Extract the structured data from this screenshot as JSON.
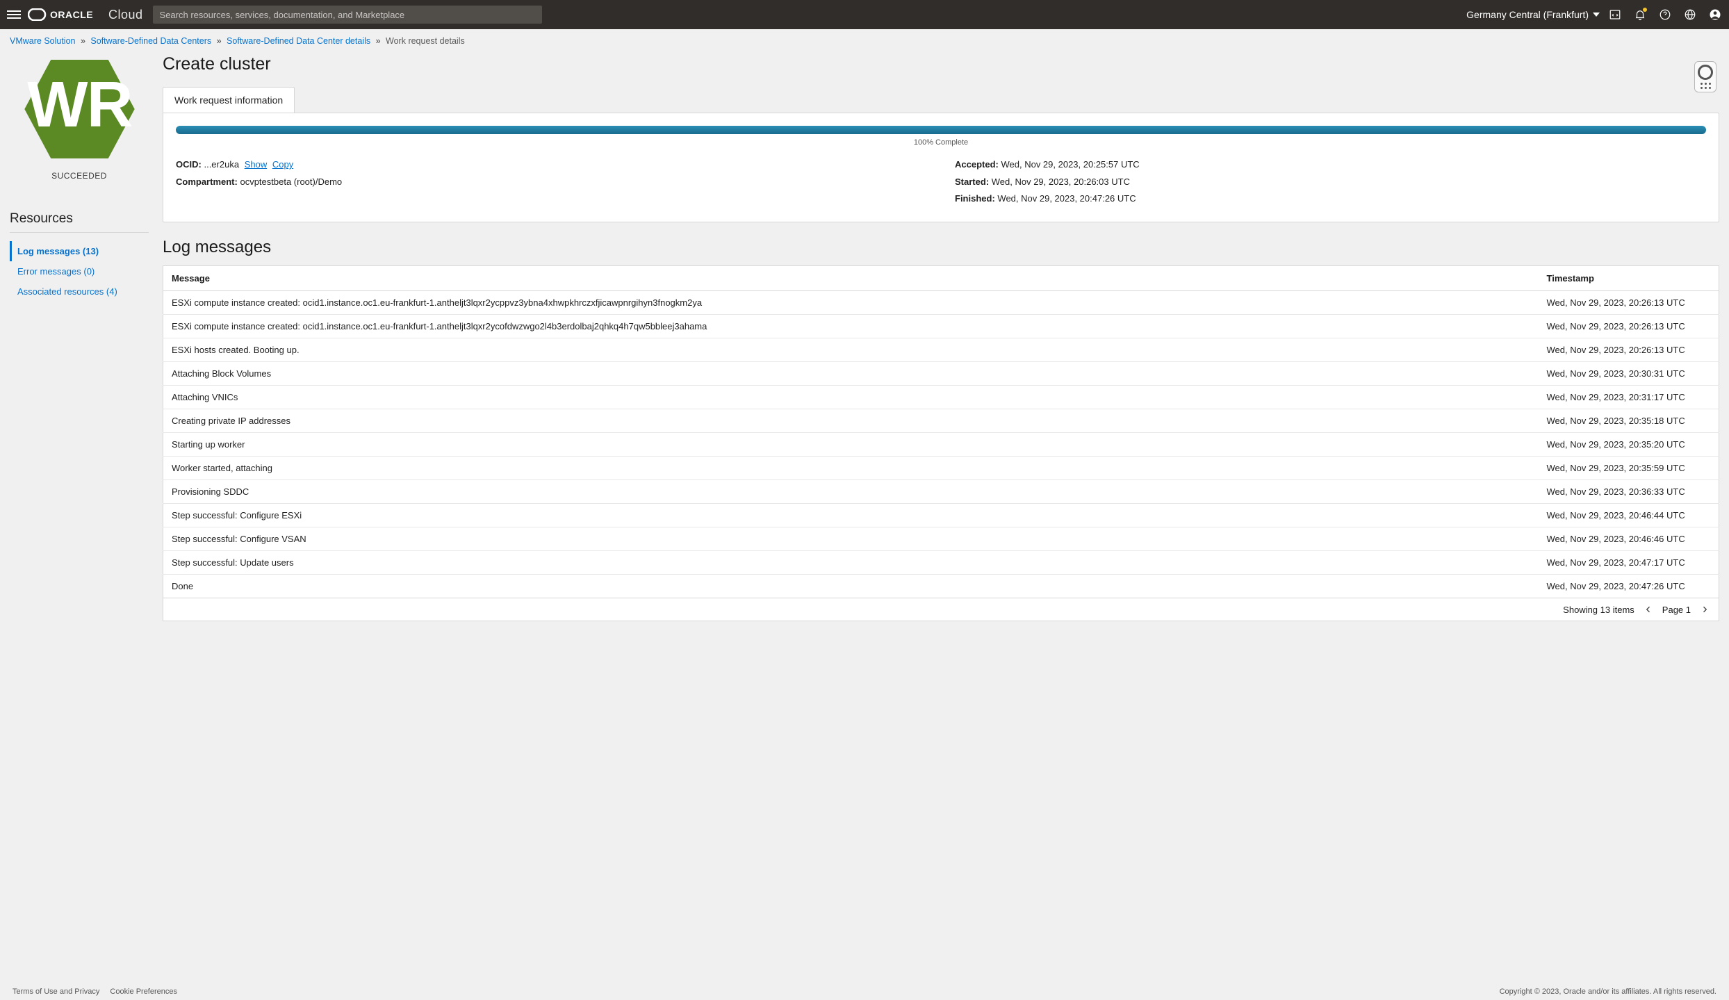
{
  "header": {
    "brand_sub": "Cloud",
    "search_placeholder": "Search resources, services, documentation, and Marketplace",
    "region": "Germany Central (Frankfurt)"
  },
  "breadcrumb": {
    "items": [
      "VMware Solution",
      "Software-Defined Data Centers",
      "Software-Defined Data Center details"
    ],
    "current": "Work request details"
  },
  "left": {
    "hex_label": "WR",
    "status": "SUCCEEDED",
    "resources_heading": "Resources",
    "items": [
      {
        "label": "Log messages (13)",
        "active": true
      },
      {
        "label": "Error messages (0)",
        "active": false
      },
      {
        "label": "Associated resources (4)",
        "active": false
      }
    ]
  },
  "title": "Create cluster",
  "tab_label": "Work request information",
  "progress": {
    "pct": 100,
    "label": "100% Complete"
  },
  "info": {
    "ocid_label": "OCID:",
    "ocid_value": "...er2uka",
    "show": "Show",
    "copy": "Copy",
    "compartment_label": "Compartment:",
    "compartment_value": "ocvptestbeta (root)/Demo",
    "accepted_label": "Accepted:",
    "accepted_value": "Wed, Nov 29, 2023, 20:25:57 UTC",
    "started_label": "Started:",
    "started_value": "Wed, Nov 29, 2023, 20:26:03 UTC",
    "finished_label": "Finished:",
    "finished_value": "Wed, Nov 29, 2023, 20:47:26 UTC"
  },
  "log_heading": "Log messages",
  "table": {
    "col_message": "Message",
    "col_timestamp": "Timestamp",
    "rows": [
      {
        "m": "ESXi compute instance created: ocid1.instance.oc1.eu-frankfurt-1.antheljt3lqxr2ycppvz3ybna4xhwpkhrczxfjicawpnrgihyn3fnogkm2ya",
        "t": "Wed, Nov 29, 2023, 20:26:13 UTC"
      },
      {
        "m": "ESXi compute instance created: ocid1.instance.oc1.eu-frankfurt-1.antheljt3lqxr2ycofdwzwgo2l4b3erdolbaj2qhkq4h7qw5bbleej3ahama",
        "t": "Wed, Nov 29, 2023, 20:26:13 UTC"
      },
      {
        "m": "ESXi hosts created. Booting up.",
        "t": "Wed, Nov 29, 2023, 20:26:13 UTC"
      },
      {
        "m": "Attaching Block Volumes",
        "t": "Wed, Nov 29, 2023, 20:30:31 UTC"
      },
      {
        "m": "Attaching VNICs",
        "t": "Wed, Nov 29, 2023, 20:31:17 UTC"
      },
      {
        "m": "Creating private IP addresses",
        "t": "Wed, Nov 29, 2023, 20:35:18 UTC"
      },
      {
        "m": "Starting up worker",
        "t": "Wed, Nov 29, 2023, 20:35:20 UTC"
      },
      {
        "m": "Worker started, attaching",
        "t": "Wed, Nov 29, 2023, 20:35:59 UTC"
      },
      {
        "m": "Provisioning SDDC",
        "t": "Wed, Nov 29, 2023, 20:36:33 UTC"
      },
      {
        "m": "Step successful: Configure ESXi",
        "t": "Wed, Nov 29, 2023, 20:46:44 UTC"
      },
      {
        "m": "Step successful: Configure VSAN",
        "t": "Wed, Nov 29, 2023, 20:46:46 UTC"
      },
      {
        "m": "Step successful: Update users",
        "t": "Wed, Nov 29, 2023, 20:47:17 UTC"
      },
      {
        "m": "Done",
        "t": "Wed, Nov 29, 2023, 20:47:26 UTC"
      }
    ]
  },
  "pager": {
    "summary": "Showing 13 items",
    "page_label": "Page 1"
  },
  "footer": {
    "terms": "Terms of Use and Privacy",
    "cookies": "Cookie Preferences",
    "copyright": "Copyright © 2023, Oracle and/or its affiliates. All rights reserved."
  }
}
